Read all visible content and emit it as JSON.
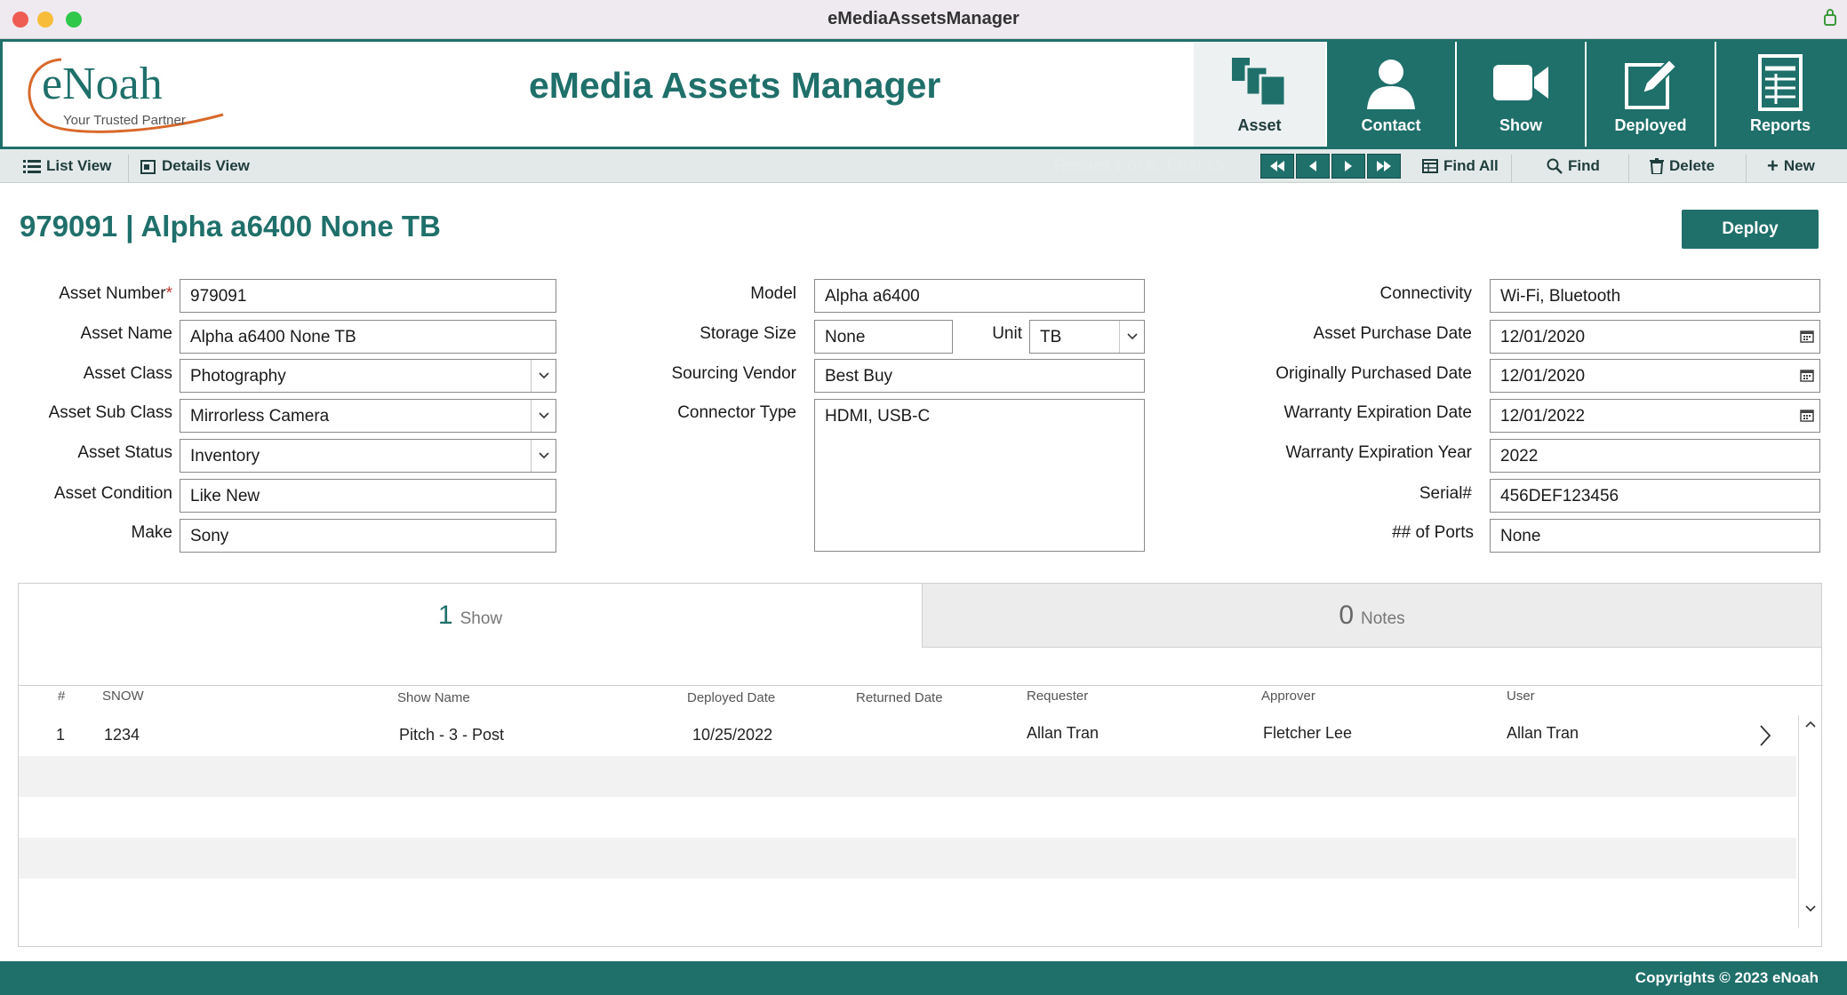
{
  "window": {
    "title": "eMediaAssetsManager"
  },
  "header": {
    "logo_text": "eNoah",
    "logo_tagline": "Your Trusted Partner",
    "app_title": "eMedia Assets Manager",
    "nav": [
      {
        "label": "Asset",
        "icon": "asset-icon",
        "active": true
      },
      {
        "label": "Contact",
        "icon": "contact-icon"
      },
      {
        "label": "Show",
        "icon": "video-camera-icon"
      },
      {
        "label": "Deployed",
        "icon": "edit-icon"
      },
      {
        "label": "Reports",
        "icon": "report-icon"
      }
    ]
  },
  "toolbar": {
    "list_view": "List View",
    "details_view": "Details View",
    "record_status": "Record 1 of 6. Total 15",
    "find_all": "Find All",
    "find": "Find",
    "delete": "Delete",
    "new": "New"
  },
  "record": {
    "title": "979091 | Alpha a6400 None TB",
    "deploy_label": "Deploy"
  },
  "form": {
    "left": {
      "asset_number_label": "Asset Number",
      "asset_number": "979091",
      "asset_name_label": "Asset Name",
      "asset_name": "Alpha a6400 None TB",
      "asset_class_label": "Asset Class",
      "asset_class": "Photography",
      "asset_sub_class_label": "Asset Sub Class",
      "asset_sub_class": "Mirrorless Camera",
      "asset_status_label": "Asset Status",
      "asset_status": "Inventory",
      "asset_condition_label": "Asset Condition",
      "asset_condition": "Like New",
      "make_label": "Make",
      "make": "Sony"
    },
    "middle": {
      "model_label": "Model",
      "model": "Alpha a6400",
      "storage_size_label": "Storage Size",
      "storage_size": "None",
      "unit_label": "Unit",
      "unit": "TB",
      "sourcing_vendor_label": "Sourcing Vendor",
      "sourcing_vendor": "Best Buy",
      "connector_type_label": "Connector Type",
      "connector_type": "HDMI, USB-C"
    },
    "right": {
      "connectivity_label": "Connectivity",
      "connectivity": "Wi-Fi, Bluetooth",
      "purchase_date_label": "Asset Purchase Date",
      "purchase_date": "12/01/2020",
      "orig_purchased_label": "Originally Purchased Date",
      "orig_purchased": "12/01/2020",
      "warranty_date_label": "Warranty Expiration Date",
      "warranty_date": "12/01/2022",
      "warranty_year_label": "Warranty Expiration Year",
      "warranty_year": "2022",
      "serial_label": "Serial#",
      "serial": "456DEF123456",
      "ports_label": "## of Ports",
      "ports": "None"
    }
  },
  "tabs": [
    {
      "count": "1",
      "label": "Show",
      "active": true
    },
    {
      "count": "0",
      "label": "Notes",
      "active": false
    }
  ],
  "table": {
    "columns": [
      "#",
      "SNOW",
      "Show Name",
      "Deployed Date",
      "Returned Date",
      "Requester",
      "Approver",
      "User"
    ],
    "rows": [
      [
        "1",
        "1234",
        "Pitch - 3 - Post",
        "10/25/2022",
        "",
        "Allan Tran",
        "Fletcher Lee",
        "Allan Tran"
      ]
    ]
  },
  "footer": {
    "copyright": "Copyrights © 2023 eNoah"
  },
  "colors": {
    "brand": "#1f6f6b",
    "required": "#c0392b",
    "logo_orange": "#d9692b"
  }
}
